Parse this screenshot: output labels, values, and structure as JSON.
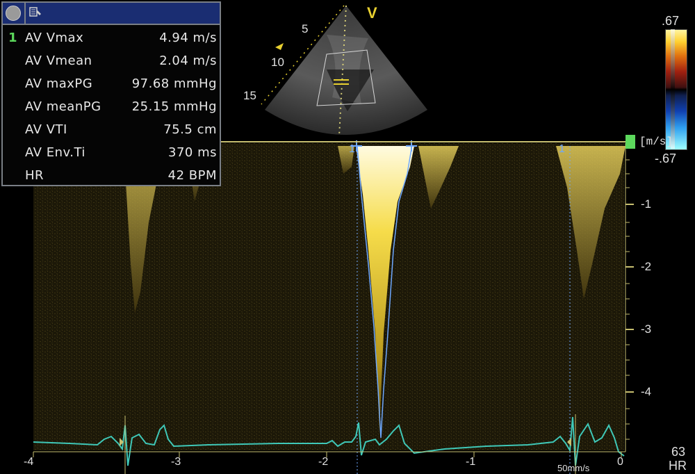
{
  "measurements": {
    "index": "1",
    "rows": [
      {
        "label": "AV Vmax",
        "value": "4.94 m/s"
      },
      {
        "label": "AV Vmean",
        "value": "2.04 m/s"
      },
      {
        "label": "AV maxPG",
        "value": "97.68 mmHg"
      },
      {
        "label": "AV meanPG",
        "value": "25.15 mmHg"
      },
      {
        "label": "AV VTI",
        "value": "75.5 cm"
      },
      {
        "label": "AV Env.Ti",
        "value": "370 ms"
      },
      {
        "label": "HR",
        "value": "42 BPM"
      }
    ]
  },
  "sector": {
    "marker": "V",
    "depth_labels": [
      "5",
      "10",
      "15"
    ]
  },
  "color_scale": {
    "top": ".67",
    "bottom": "-.67",
    "unit": "[m/s]"
  },
  "velocity_axis": {
    "ticks": [
      "-1",
      "-2",
      "-3",
      "-4"
    ]
  },
  "time_axis": {
    "ticks": [
      "-4",
      "-3",
      "-2",
      "-1",
      "0"
    ],
    "sweep_speed": "50mm/s"
  },
  "caliper_marks": [
    "1",
    "1",
    "1"
  ],
  "heart_rate": {
    "value": "63",
    "label": "HR"
  },
  "colors": {
    "doppler": "#e8d030",
    "ecg": "#3fc8b8",
    "trace": "#6ea8ff",
    "baseline": "#c8c070",
    "marker_green": "#5cd85c",
    "title_bar": "#1a2d72"
  }
}
